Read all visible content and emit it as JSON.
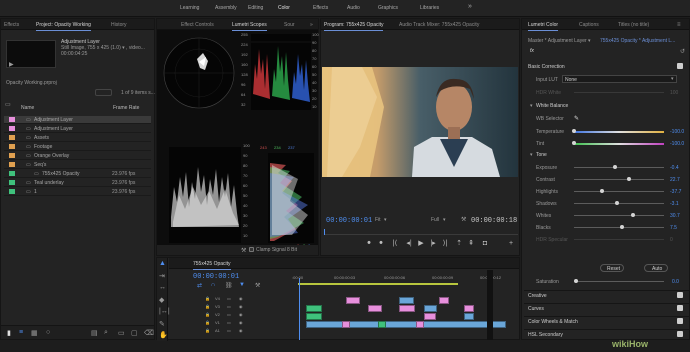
{
  "workspaces": [
    "Learning",
    "Assembly",
    "Editing",
    "Color",
    "Effects",
    "Audio",
    "Graphics",
    "Libraries"
  ],
  "active_workspace": "Color",
  "menu_icon": "double-chevron-right",
  "project_panel": {
    "tabs": [
      "Effects",
      "Project: Opacity Working",
      "History"
    ],
    "active_tab": "Project: Opacity Working",
    "preview": {
      "name": "Adjustment Layer",
      "line2": "Still Image, 755 x 425 (1.0)  ▾ , video...",
      "line3": "00:00:04:25"
    },
    "project_file": "Opacity Working.prproj",
    "item_count": "1 of 9 items s...",
    "columns": [
      "Name",
      "Frame Rate"
    ],
    "rows": [
      {
        "name": "Adjustment Layer",
        "rate": "",
        "color": "#e78fdc",
        "indent": 1,
        "selected": true
      },
      {
        "name": "Adjustment Layer",
        "rate": "",
        "color": "#e78fdc",
        "indent": 1
      },
      {
        "name": "Assets",
        "rate": "",
        "color": "#e0a050",
        "indent": 1
      },
      {
        "name": "Footage",
        "rate": "",
        "color": "#e0a050",
        "indent": 1
      },
      {
        "name": "Orange Overlay",
        "rate": "",
        "color": "#e0a050",
        "indent": 1
      },
      {
        "name": "Seq's",
        "rate": "",
        "color": "#e0a050",
        "indent": 1
      },
      {
        "name": "755x425 Opacity",
        "rate": "23.976 fps",
        "color": "#3fc17c",
        "indent": 2
      },
      {
        "name": "Teal underlay",
        "rate": "23.976 fps",
        "color": "#3fc17c",
        "indent": 1
      },
      {
        "name": "1",
        "rate": "23.976 fps",
        "color": "#3fc17c",
        "indent": 1
      }
    ]
  },
  "scopes_panel": {
    "tabs": [
      "Effect Controls",
      "Lumetri Scopes",
      "Sour"
    ],
    "active_tab": "Lumetri Scopes",
    "parade_ticks": [
      "100",
      "90",
      "80",
      "70",
      "60",
      "50",
      "40",
      "30",
      "20",
      "10",
      "0"
    ],
    "waveform_ticks": [
      "100",
      "90",
      "80",
      "70",
      "60",
      "50",
      "40",
      "30",
      "20",
      "10",
      "0"
    ],
    "left_ticks": [
      "255",
      "224",
      "192",
      "160",
      "128",
      "96",
      "64",
      "32"
    ],
    "histo_values": {
      "r": "243",
      "g": "234",
      "b": "237"
    },
    "histo_bottom": {
      "r": "0",
      "g": "3",
      "b": "8"
    },
    "clamp_signal": "Clamp Signal",
    "bit_depth": "8 Bit"
  },
  "program_panel": {
    "tabs": [
      "Program: 755x425 Opacity",
      "Audio Track Mixer: 755x425 Opacity"
    ],
    "active_tab": "Program: 755x425 Opacity",
    "current_time": "00:00:00:01",
    "fit": "Fit",
    "quality": "Full",
    "duration": "00:00:00:18"
  },
  "timeline_panel": {
    "sequence": "755x425 Opacity",
    "timecode": "00:00:00:01",
    "ruler": [
      ":00:00",
      "00:00:00:03",
      "00:00:00:06",
      "00:00:00:09",
      "00:00:00:12"
    ],
    "tracks": [
      "V4",
      "V3",
      "V2",
      "V1",
      "A1"
    ]
  },
  "lumetri_panel": {
    "tabs": [
      "Lumetri Color",
      "Captions",
      "Titles (no title)"
    ],
    "active_tab": "Lumetri Color",
    "breadcrumb_left": "Master * Adjustment Layer",
    "breadcrumb_right": "755x425 Opacity * Adjustment L...",
    "fx_label": "fx",
    "basic_correction": "Basic Correction",
    "input_lut_label": "Input LUT",
    "input_lut_value": "None",
    "hdr_white_label": "HDR White",
    "hdr_white_value": "100",
    "white_balance": "White Balance",
    "wb_selector": "WB Selector",
    "tone": "Tone",
    "sliders": [
      {
        "label": "Temperature",
        "value": "-100.0",
        "pos": 0.0,
        "track": "temp"
      },
      {
        "label": "Tint",
        "value": "-100.0",
        "pos": 0.0,
        "track": "tint"
      }
    ],
    "tone_sliders": [
      {
        "label": "Exposure",
        "value": "-0.4",
        "pos": 0.45
      },
      {
        "label": "Contrast",
        "value": "22.7",
        "pos": 0.61
      },
      {
        "label": "Highlights",
        "value": "-37.7",
        "pos": 0.31
      },
      {
        "label": "Shadows",
        "value": "-3.1",
        "pos": 0.48
      },
      {
        "label": "Whites",
        "value": "30.7",
        "pos": 0.65
      },
      {
        "label": "Blacks",
        "value": "7.5",
        "pos": 0.53
      },
      {
        "label": "HDR Specular",
        "value": "0",
        "pos": 0.0,
        "disabled": true
      }
    ],
    "reset": "Reset",
    "auto": "Auto",
    "saturation_label": "Saturation",
    "saturation_value": "0.0",
    "sections": [
      "Creative",
      "Curves",
      "Color Wheels & Match",
      "HSL Secondary"
    ]
  },
  "watermark": "wikiHow",
  "colors": {
    "accent": "#6b8fd6",
    "timecode": "#4f8ef0",
    "clip_video": "#e78fdc",
    "clip_blue": "#6aa6d8",
    "clip_green": "#3fc17c"
  }
}
